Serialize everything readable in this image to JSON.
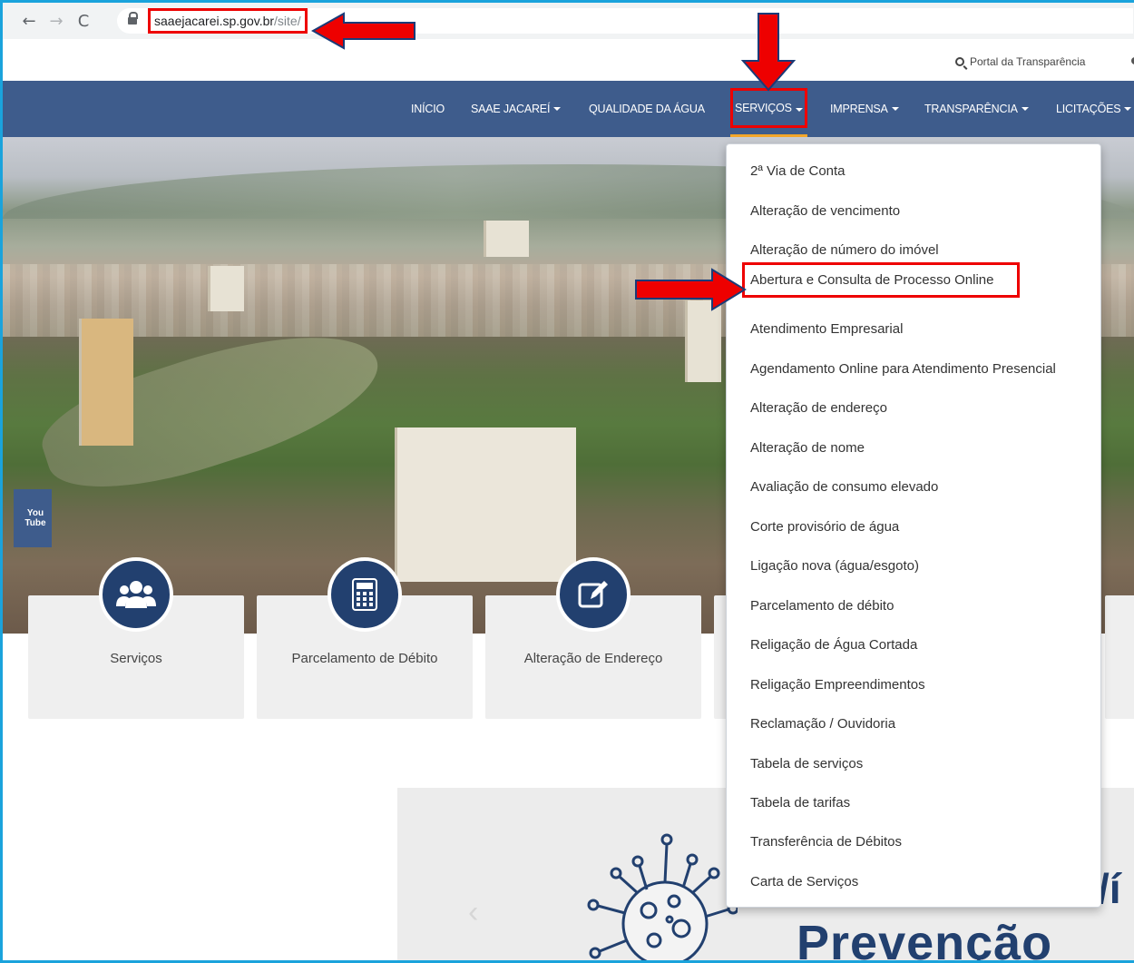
{
  "browser": {
    "url_domain": "saaejacarei.sp.gov.br",
    "url_path": "/site/",
    "back_glyph": "←",
    "forward_glyph": "→",
    "reload_glyph": "C"
  },
  "utility": {
    "portal_label": "Portal da Transparência"
  },
  "nav": {
    "items": [
      {
        "label": "INÍCIO",
        "dropdown": false
      },
      {
        "label": "SAAE JACAREÍ",
        "dropdown": true
      },
      {
        "label": "QUALIDADE DA ÁGUA",
        "dropdown": false
      },
      {
        "label": "SERVIÇOS",
        "dropdown": true,
        "active": true
      },
      {
        "label": "IMPRENSA",
        "dropdown": true
      },
      {
        "label": "TRANSPARÊNCIA",
        "dropdown": true
      },
      {
        "label": "LICITAÇÕES",
        "dropdown": true
      }
    ]
  },
  "dropdown": {
    "items": [
      "2ª Via de Conta",
      "Alteração de vencimento",
      "Alteração de número do imóvel",
      "Abertura e Consulta de Processo Online",
      "Atendimento Empresarial",
      "Agendamento Online para Atendimento Presencial",
      "Alteração de endereço",
      "Alteração de nome",
      "Avaliação de consumo elevado",
      "Corte provisório de água",
      "Ligação nova (água/esgoto)",
      "Parcelamento de débito",
      "Religação de Água Cortada",
      "Religação Empreendimentos",
      "Reclamação / Ouvidoria",
      "Tabela de serviços",
      "Tabela de tarifas",
      "Transferência de Débitos",
      "Carta de Serviços"
    ]
  },
  "social": {
    "youtube_line1": "You",
    "youtube_line2": "Tube"
  },
  "cards": [
    {
      "label": "Serviços",
      "icon": "users-icon"
    },
    {
      "label": "Parcelamento de Débito",
      "icon": "calculator-icon"
    },
    {
      "label": "Alteração de Endereço",
      "icon": "edit-icon"
    }
  ],
  "banner": {
    "text_partial": "/í",
    "text_main": "Prevenção",
    "prev_glyph": "‹"
  },
  "colors": {
    "nav_bg": "#3e5c8c",
    "icon_circle": "#22406f",
    "annotation_red": "#e00000",
    "frame_border": "#1aa3dc"
  }
}
